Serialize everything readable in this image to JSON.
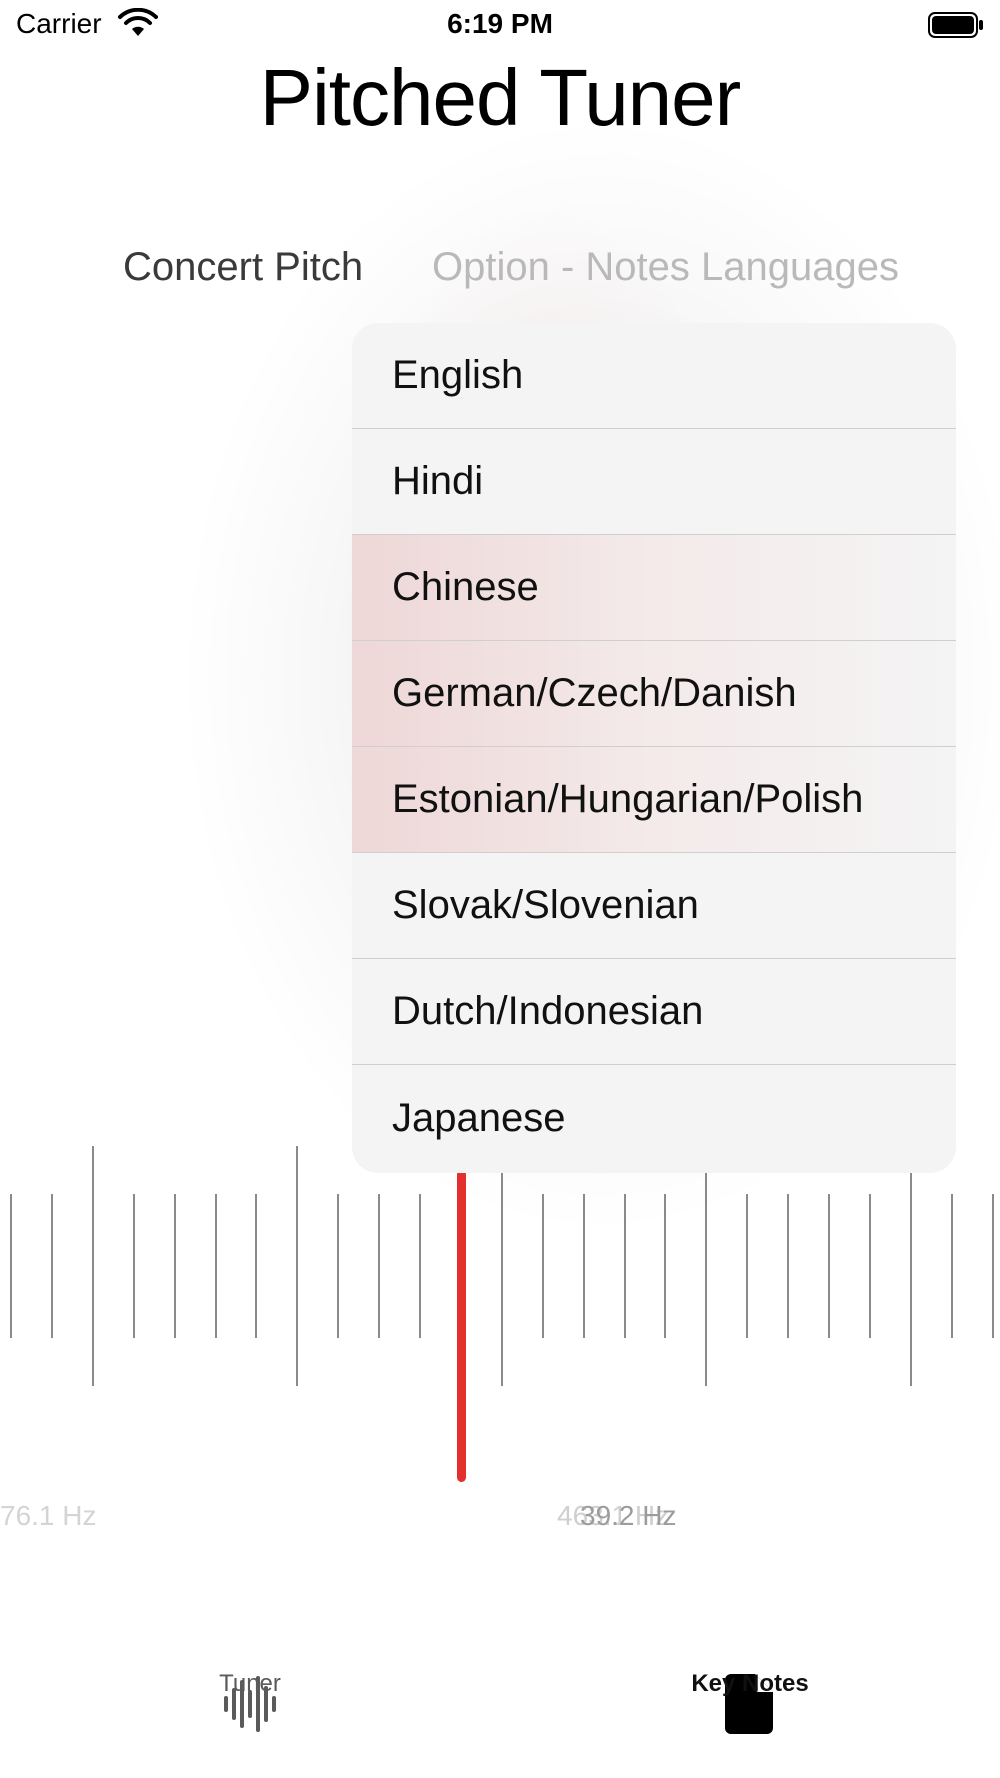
{
  "status_bar": {
    "carrier": "Carrier",
    "time": "6:19 PM"
  },
  "app": {
    "title": "Pitched Tuner"
  },
  "segments": {
    "concert_pitch": "Concert Pitch",
    "option_notes_languages": "Option - Notes Languages"
  },
  "language_menu": {
    "items": [
      "English",
      "Hindi",
      "Chinese",
      "German/Czech/Danish",
      "Estonian/Hungarian/Polish",
      "Slovak/Slovenian",
      "Dutch/Indonesian",
      "Japanese"
    ]
  },
  "tuner": {
    "left_hz": "76.1 Hz",
    "center_hz_back": "463.1 Hz",
    "center_hz_front": "39.2 Hz"
  },
  "tab_bar": {
    "tuner_label": "Tuner",
    "key_notes_label": "Key Notes",
    "tuner_icon": "waveform-icon",
    "key_notes_icon": "document-icon"
  },
  "colors": {
    "needle": "#e3302f",
    "tick": "#8a8a8a",
    "inactive_segment": "#b9b9b9"
  }
}
